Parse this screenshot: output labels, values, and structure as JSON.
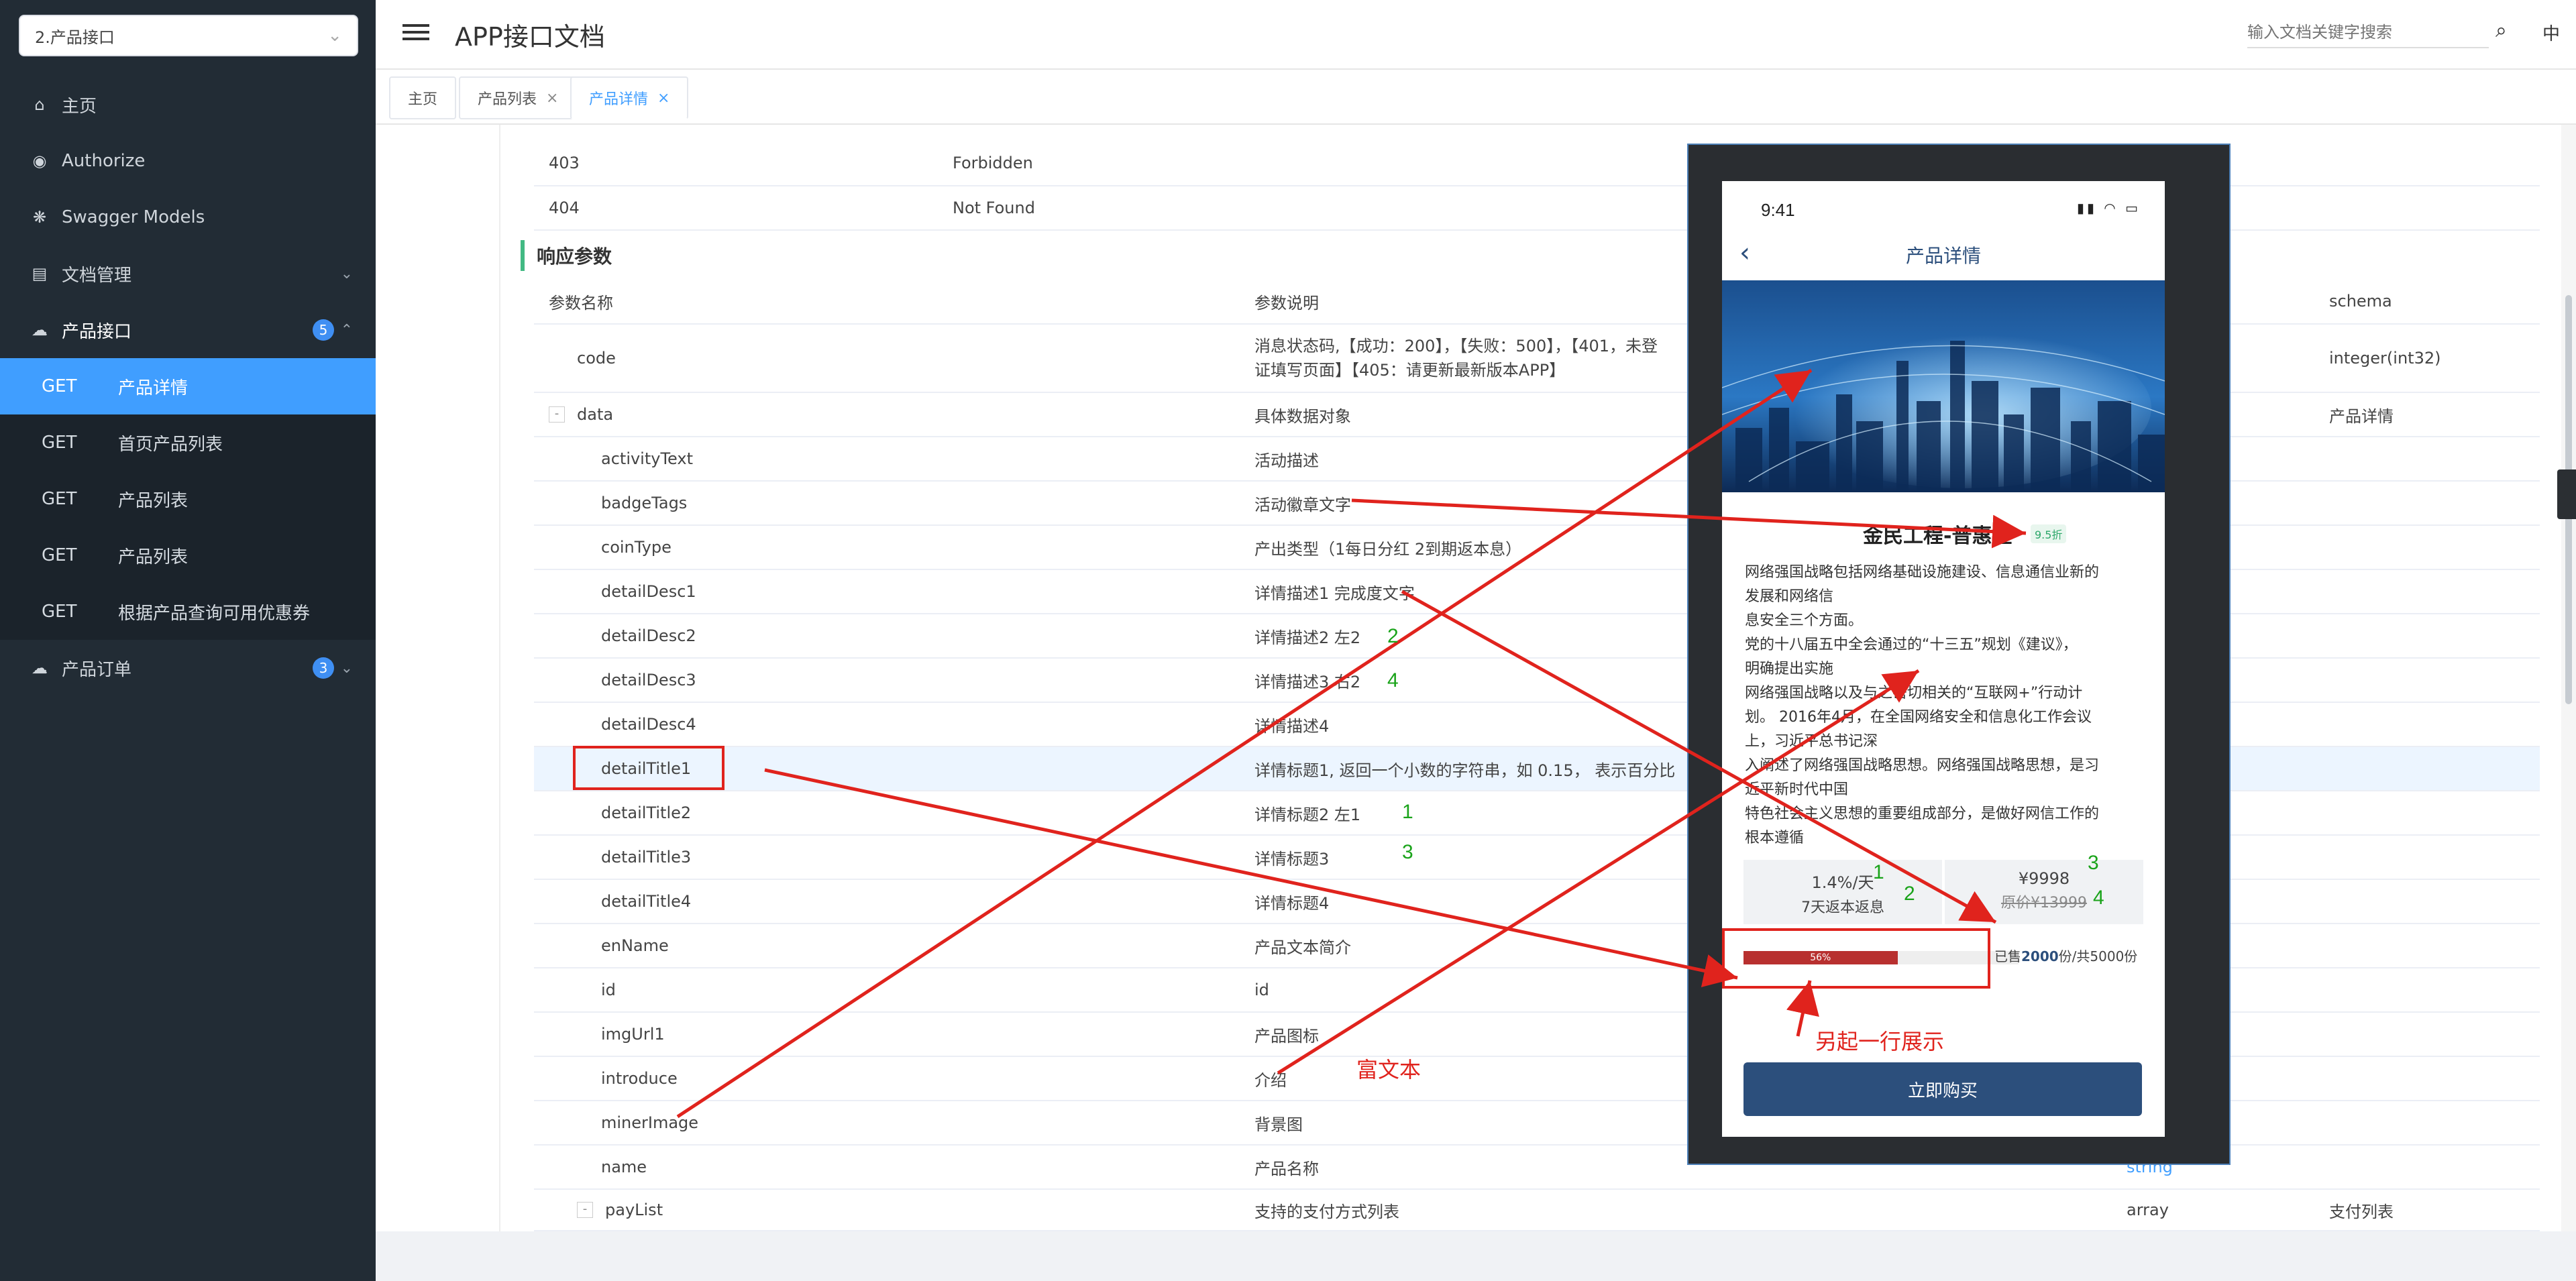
{
  "sidebar": {
    "project_select": "2.产品接口",
    "menu": {
      "home": "主页",
      "authorize": "Authorize",
      "swagger_models": "Swagger Models",
      "doc_manage": "文档管理",
      "product_api": "产品接口",
      "product_api_badge": "5",
      "product_order": "产品订单",
      "product_order_badge": "3"
    },
    "sub_items": [
      {
        "method": "GET",
        "label": "产品详情"
      },
      {
        "method": "GET",
        "label": "首页产品列表"
      },
      {
        "method": "GET",
        "label": "产品列表"
      },
      {
        "method": "GET",
        "label": "产品列表"
      },
      {
        "method": "GET",
        "label": "根据产品查询可用优惠券"
      }
    ]
  },
  "header": {
    "title": "APP接口文档",
    "search_placeholder": "输入文档关键字搜索",
    "lang": "中"
  },
  "tabs": [
    {
      "label": "主页"
    },
    {
      "label": "产品列表",
      "close": "×"
    },
    {
      "label": "产品详情",
      "close": "×"
    }
  ],
  "status_rows": [
    {
      "code": "403",
      "desc": "Forbidden"
    },
    {
      "code": "404",
      "desc": "Not Found"
    }
  ],
  "response": {
    "title": "响应参数",
    "headers": {
      "name": "参数名称",
      "desc": "参数说明",
      "schema": "schema"
    },
    "rows": [
      {
        "name": "code",
        "desc_line1": "消息状态码,【成功：200】，【失败：500】，【401，未登",
        "desc_line2": "证填写页面】【405：请更新最新版本APP】",
        "type": "",
        "schema": "integer(int32)"
      },
      {
        "name": "data",
        "toggle": "-",
        "desc": "具体数据对象",
        "schema": "产品详情"
      },
      {
        "name": "activityText",
        "desc": "活动描述"
      },
      {
        "name": "badgeTags",
        "desc": "活动徽章文字"
      },
      {
        "name": "coinType",
        "desc": "产出类型（1每日分红 2到期返本息）"
      },
      {
        "name": "detailDesc1",
        "desc": "详情描述1 完成度文字"
      },
      {
        "name": "detailDesc2",
        "desc": "详情描述2 左2"
      },
      {
        "name": "detailDesc3",
        "desc": "详情描述3 右2"
      },
      {
        "name": "detailDesc4",
        "desc": "详情描述4"
      },
      {
        "name": "detailTitle1",
        "desc": "详情标题1, 返回一个小数的字符串，如 0.15， 表示百分比"
      },
      {
        "name": "detailTitle2",
        "desc": "详情标题2 左1"
      },
      {
        "name": "detailTitle3",
        "desc": "详情标题3"
      },
      {
        "name": "detailTitle4",
        "desc": "详情标题4"
      },
      {
        "name": "enName",
        "desc": "产品文本简介"
      },
      {
        "name": "id",
        "desc": "id"
      },
      {
        "name": "imgUrl1",
        "desc": "产品图标"
      },
      {
        "name": "introduce",
        "desc": "介绍"
      },
      {
        "name": "minerImage",
        "desc": "背景图"
      },
      {
        "name": "name",
        "desc": "产品名称",
        "type": "string"
      },
      {
        "name": "payList",
        "toggle": "-",
        "desc": "支持的支付方式列表",
        "type": "array",
        "schema": "支付列表"
      }
    ]
  },
  "phone": {
    "time": "9:41",
    "nav_title": "产品详情",
    "product_name": "金民工程-普惠型",
    "badge": "9.5折",
    "intro_lines": [
      "网络强国战略包括网络基础设施建设、信息通信业新的",
      "发展和网络信",
      "息安全三个方面。",
      " 党的十八届五中全会通过的“十三五”规划《建议》，",
      "明确提出实施",
      "网络强国战略以及与之密切相关的“互联网+”行动计",
      "划。 2016年4月，在全国网络安全和信息化工作会议",
      "上，习近平总书记深",
      "入阐述了网络强国战略思想。网络强国战略思想，是习",
      "近平新时代中国",
      "特色社会主义思想的重要组成部分，是做好网信工作的",
      "根本遵循"
    ],
    "rate": "1.4%/天",
    "rate_desc": "7天返本返息",
    "price": "¥9998",
    "orig_price": "原价¥13999",
    "progress_percent": 56,
    "progress_label": "56%",
    "sold_prefix": "已售",
    "sold_count": "2000",
    "sold_suffix": "份/共5000份",
    "buy_label": "立即购买"
  },
  "annotations": {
    "rich_text": "富文本",
    "new_line": "另起一行展示",
    "numbers": [
      "2",
      "4",
      "1",
      "3",
      "1",
      "2",
      "3",
      "4"
    ]
  },
  "colors": {
    "sidebar_bg": "#222c35",
    "active_blue": "#409eff",
    "annotation_red": "#e0231d",
    "annotation_green": "#1aa31a",
    "phone_brand": "#2c4f7c",
    "progress_red": "#b8302f"
  }
}
